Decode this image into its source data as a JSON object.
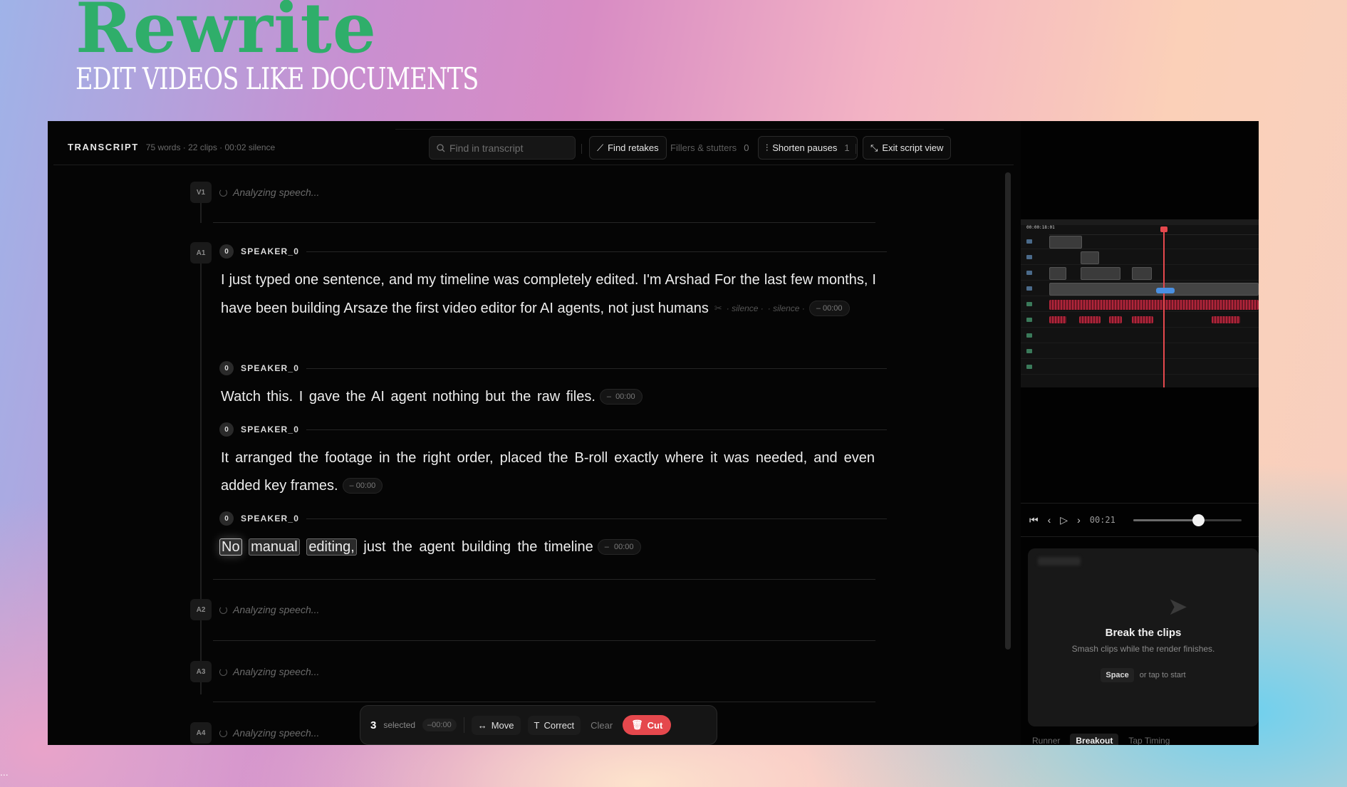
{
  "brand": {
    "logo": "Rewrite",
    "tagline": "EDIT VIDEOS LIKE DOCUMENTS"
  },
  "header": {
    "title": "TRANSCRIPT",
    "stats": "75 words · 22 clips · 00:02 silence",
    "search_placeholder": "Find in transcript",
    "find_retakes": "Find retakes",
    "fillers_label": "Fillers & stutters",
    "fillers_count": "0",
    "shorten_label": "Shorten pauses",
    "shorten_count": "1",
    "exit_label": "Exit script view"
  },
  "tracks": {
    "v1": {
      "tag": "V1",
      "status": "Analyzing speech..."
    },
    "a1": {
      "tag": "A1"
    },
    "a2": {
      "tag": "A2",
      "status": "Analyzing speech..."
    },
    "a3": {
      "tag": "A3",
      "status": "Analyzing speech..."
    },
    "a4": {
      "tag": "A4",
      "status": "Analyzing speech..."
    }
  },
  "segments": [
    {
      "speaker_index": "0",
      "speaker": "SPEAKER_0",
      "text_line": "I just typed one sentence, and my timeline was completely edited. I'm Arshad For the last few months, I have been building Arsaze the first video editor for AI agents, not just humans",
      "silence_1": "· silence ·",
      "silence_2": "· silence ·",
      "duration": "– 00:00"
    },
    {
      "speaker_index": "0",
      "speaker": "SPEAKER_0",
      "text_line": "Watch this. I gave the AI agent nothing but the raw files.",
      "duration": "– 00:00"
    },
    {
      "speaker_index": "0",
      "speaker": "SPEAKER_0",
      "text_line": "It arranged the footage in the right order, placed the B-roll exactly where it was needed, and even added key frames.",
      "duration": "– 00:00"
    },
    {
      "speaker_index": "0",
      "speaker": "SPEAKER_0",
      "selected_words": [
        "No",
        "manual",
        "editing,"
      ],
      "text_rest": "just the agent building the timeline",
      "duration": "– 00:00"
    }
  ],
  "actionbar": {
    "count": "3",
    "selected_label": "selected",
    "duration": "–00:00",
    "move": "Move",
    "correct": "Correct",
    "clear": "Clear",
    "cut": "Cut"
  },
  "preview": {
    "timecode": "00:00:18:01",
    "player_time": "00:21",
    "scrub_fraction": 0.6
  },
  "game": {
    "title": "Break the clips",
    "subtitle": "Smash clips while the render finishes.",
    "key": "Space",
    "start_hint": "or tap to start"
  },
  "tabs": [
    "Runner",
    "Breakout",
    "Tap Timing"
  ],
  "active_tab": "Breakout",
  "footer_ellipsis": "..."
}
